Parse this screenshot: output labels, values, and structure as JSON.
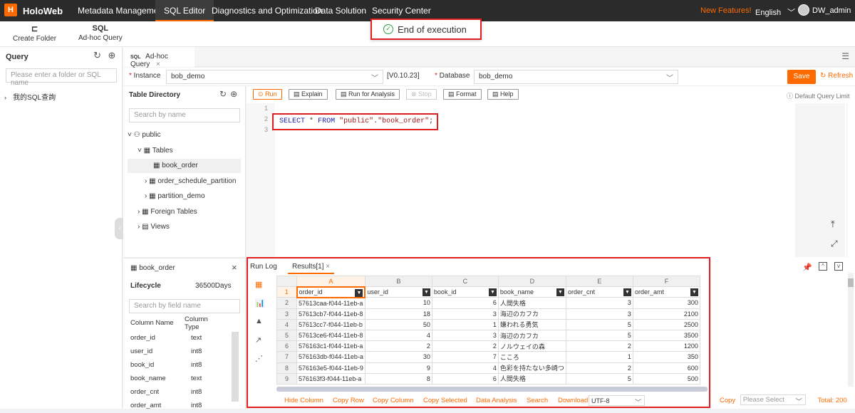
{
  "topbar": {
    "logo": "H",
    "brand": "HoloWeb",
    "nav": [
      "Metadata Management",
      "SQL Editor",
      "Diagnostics and Optimization",
      "Data Solution",
      "Security Center"
    ],
    "active_nav": "SQL Editor",
    "new_features": "New Features!",
    "language": "English",
    "user": "DW_admin"
  },
  "toolbar": {
    "create_folder": "Create Folder",
    "adhoc_query": "Ad-hoc Query",
    "sql_icon": "SQL"
  },
  "toast": {
    "text": "End of execution"
  },
  "left": {
    "title": "Query",
    "search_placeholder": "Please enter a folder or SQL name",
    "folder": "我的SQL查詢"
  },
  "tab": {
    "label": "Ad-hoc Query",
    "prefix": "SQL"
  },
  "instance": {
    "label": "Instance",
    "value": "bob_demo",
    "version": "[V0.10.23]",
    "db_label": "Database",
    "db_value": "bob_demo",
    "save": "Save",
    "refresh": "Refresh"
  },
  "table_dir": {
    "title": "Table Directory",
    "search_placeholder": "Search by name",
    "schema": "public",
    "tables_label": "Tables",
    "tables": [
      "book_order",
      "order_schedule_partition",
      "partition_demo"
    ],
    "foreign": "Foreign Tables",
    "views": "Views"
  },
  "sqlbar": {
    "run": "Run",
    "explain": "Explain",
    "analysis": "Run for Analysis",
    "stop": "Stop",
    "format": "Format",
    "help": "Help",
    "limit": "Default Query Limit"
  },
  "editor": {
    "lines": [
      "1",
      "2",
      "3"
    ],
    "kw_select": "SELECT",
    "star": "*",
    "kw_from": "FROM",
    "schema": "\"public\"",
    "dot": ".",
    "table": "\"book_order\"",
    "semi": ";"
  },
  "table_info": {
    "name": "book_order",
    "lifecycle_label": "Lifecycle",
    "lifecycle_value": "36500Days",
    "field_search": "Search by field name",
    "col_name": "Column Name",
    "col_type": "Column Type",
    "columns": [
      {
        "name": "order_id",
        "type": "text"
      },
      {
        "name": "user_id",
        "type": "int8"
      },
      {
        "name": "book_id",
        "type": "int8"
      },
      {
        "name": "book_name",
        "type": "text"
      },
      {
        "name": "order_cnt",
        "type": "int8"
      },
      {
        "name": "order_amt",
        "type": "int8"
      }
    ]
  },
  "results": {
    "run_log": "Run Log",
    "results_tab": "Results[1]",
    "col_letters": [
      "A",
      "B",
      "C",
      "D",
      "E",
      "F"
    ],
    "headers": [
      "order_id",
      "user_id",
      "book_id",
      "book_name",
      "order_cnt",
      "order_amt"
    ],
    "rows": [
      [
        "57613caa-f044-11eb-a",
        "10",
        "6",
        "人間失格",
        "3",
        "300"
      ],
      [
        "57613cb7-f044-11eb-8",
        "18",
        "3",
        "海辺のカフカ",
        "3",
        "2100"
      ],
      [
        "57613cc7-f044-11eb-b",
        "50",
        "1",
        "嫌われる勇気",
        "5",
        "2500"
      ],
      [
        "57613ce6-f044-11eb-8",
        "4",
        "3",
        "海辺のカフカ",
        "5",
        "3500"
      ],
      [
        "576163c1-f044-11eb-a",
        "2",
        "2",
        "ノルウェイの森",
        "2",
        "1200"
      ],
      [
        "576163db-f044-11eb-a",
        "30",
        "7",
        "こころ",
        "1",
        "350"
      ],
      [
        "576163e5-f044-11eb-9",
        "9",
        "4",
        "色彩を持たない多崎つ",
        "2",
        "600"
      ],
      [
        "576163f3-f044-11eb-a",
        "8",
        "6",
        "人間失格",
        "5",
        "500"
      ]
    ],
    "actions": [
      "Hide Column",
      "Copy Row",
      "Copy Column",
      "Copy Selected",
      "Data Analysis",
      "Search",
      "Download"
    ],
    "encoding": "UTF-8",
    "copy": "Copy",
    "copy_placeholder": "Please Select",
    "total": "Total: 200"
  }
}
